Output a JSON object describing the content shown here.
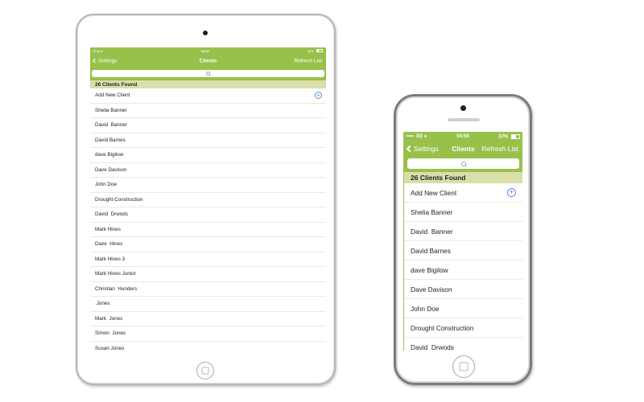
{
  "tablet": {
    "status": {
      "carrier": "iPad",
      "time": "04:57",
      "battery": "35%",
      "battery_level": 0.35
    },
    "nav": {
      "back_label": "Settings",
      "title": "Clients",
      "refresh_label": "Refresh List"
    },
    "header": "26 Clients Found",
    "add_label": "Add New Client",
    "clients": [
      "Shelia Banner",
      "David  Banner",
      "David Barnes",
      "dave Bigilow",
      "Dave Davison",
      "John Doe",
      "Drought Construction",
      "David  Drwods",
      "Mark Hines",
      "Dave  Hines",
      "Mark Hines 3",
      "Mark Hines Junior",
      "Christian  Hunders",
      " Jones",
      "Mark  Jones",
      "Simon  Jones",
      "Susan Jones"
    ]
  },
  "phone": {
    "status": {
      "carrier": "EE",
      "time": "04:58",
      "battery": "57%",
      "battery_level": 0.57
    },
    "nav": {
      "back_label": "Settings",
      "title": "Clients",
      "refresh_label": "Refresh List"
    },
    "header": "26 Clients Found",
    "add_label": "Add New Client",
    "clients": [
      "Shelia Banner",
      "David  Banner",
      "David Barnes",
      "dave Bigilow",
      "Dave Davison",
      "John Doe",
      "Drought Construction",
      "David  Drwods"
    ]
  },
  "icons": {
    "back": "chevron-left-icon",
    "search": "search-icon",
    "add": "plus-circle-icon",
    "wifi": "wifi-icon",
    "battery": "battery-icon"
  },
  "colors": {
    "accent": "#98c14b",
    "header_bg": "#d9dfa9",
    "add_icon": "#5b8fd8"
  }
}
